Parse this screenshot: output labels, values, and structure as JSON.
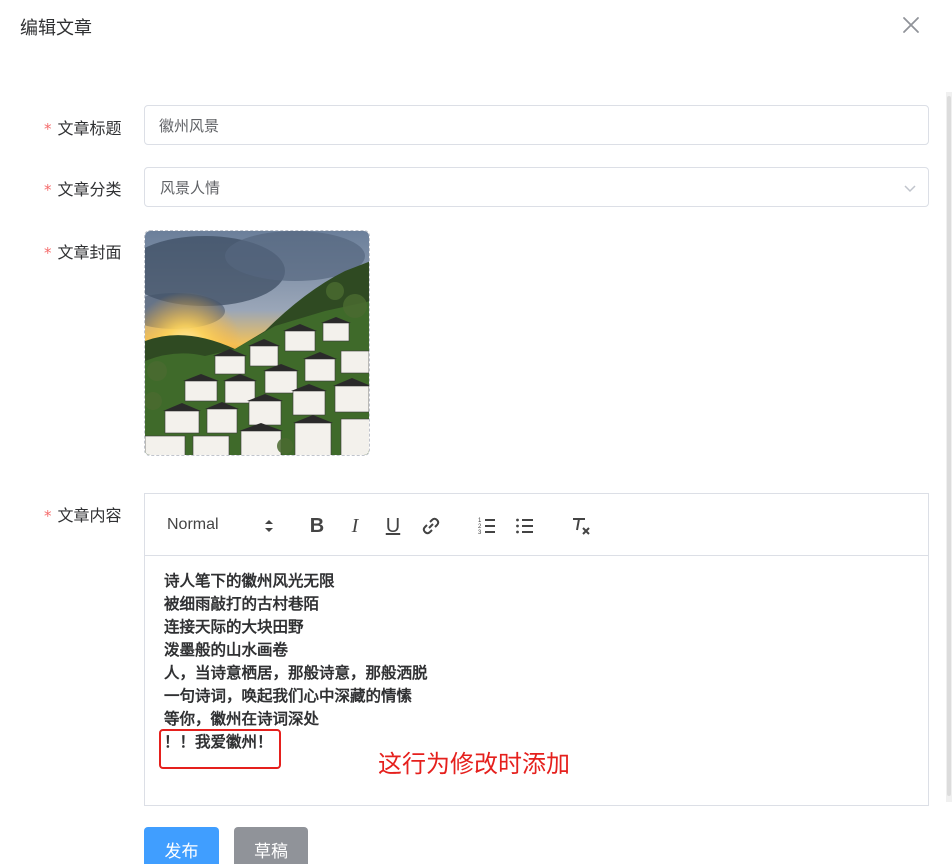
{
  "dialog": {
    "title": "编辑文章",
    "close_icon": "close-icon"
  },
  "form": {
    "title_field": {
      "label": "文章标题",
      "required_mark": "*",
      "value": "徽州风景"
    },
    "category_field": {
      "label": "文章分类",
      "required_mark": "*",
      "value": "风景人情",
      "icon": "chevron-down-icon"
    },
    "cover_field": {
      "label": "文章封面",
      "required_mark": "*",
      "image_description": "cover-image"
    },
    "content_field": {
      "label": "文章内容",
      "required_mark": "*"
    }
  },
  "editor": {
    "header_picker": "Normal",
    "toolbar": {
      "bold": "B",
      "italic": "I",
      "underline": "U",
      "link_icon": "link-icon",
      "ordered_list_icon": "ordered-list-icon",
      "bullet_list_icon": "bullet-list-icon",
      "clean_icon": "clear-format-icon"
    },
    "lines": [
      "诗人笔下的徽州风光无限",
      "被细雨敲打的古村巷陌",
      "连接天际的大块田野",
      "泼墨般的山水画卷",
      "人，当诗意栖居，那般诗意，那般洒脱",
      "一句诗词，唤起我们心中深藏的情愫",
      "等你，徽州在诗词深处",
      "！！我爱徽州！"
    ]
  },
  "annotation": {
    "text": "这行为修改时添加",
    "color": "#e5201d"
  },
  "buttons": {
    "publish": "发布",
    "draft": "草稿"
  },
  "colors": {
    "primary": "#409eff",
    "info": "#909399",
    "required": "#f56c6c"
  }
}
